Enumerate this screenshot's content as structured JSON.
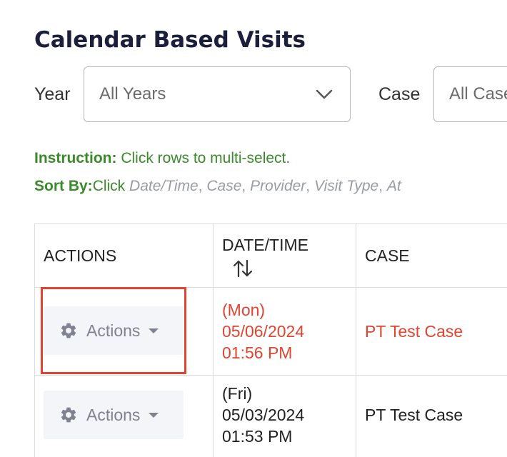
{
  "page": {
    "title": "Calendar Based Visits"
  },
  "filters": {
    "year_label": "Year",
    "year_value": "All Years",
    "case_label": "Case",
    "case_value": "All Cases"
  },
  "instructions": {
    "instruction_label": "Instruction:",
    "instruction_text": " Click rows to multi-select.",
    "sort_label": "Sort By:",
    "sort_prefix": "Click ",
    "sort_options": [
      "Date/Time",
      "Case",
      "Provider",
      "Visit Type",
      "At"
    ]
  },
  "table": {
    "headers": [
      "ACTIONS",
      "DATE/TIME",
      "CASE"
    ],
    "rows": [
      {
        "action_label": "Actions",
        "day": "(Mon)",
        "date": "05/06/2024",
        "time": "01:56 PM",
        "case": "PT Test Case",
        "highlighted": true
      },
      {
        "action_label": "Actions",
        "day": "(Fri)",
        "date": "05/03/2024",
        "time": "01:53 PM",
        "case": "PT Test Case",
        "highlighted": false
      }
    ]
  },
  "colors": {
    "title": "#1b1f3b",
    "instruction_green": "#3a8a2b",
    "highlight_red": "#e2442f",
    "sort_gray": "#9a9ca5",
    "button_bg": "#f4f5f8"
  },
  "icons": [
    "chevron-down-icon",
    "sort-arrows-icon",
    "gear-icon",
    "caret-down-icon"
  ]
}
